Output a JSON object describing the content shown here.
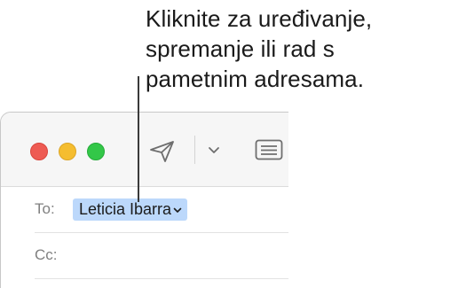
{
  "callout": {
    "lines": [
      "Kliknite za uređivanje,",
      "spremanje ili rad s",
      "pametnim adresama."
    ]
  },
  "window": {
    "traffic_lights": [
      "close",
      "minimize",
      "zoom"
    ],
    "toolbar": {
      "icons": [
        "send-icon",
        "chevron-down-icon",
        "header-fields-icon"
      ]
    },
    "fields": {
      "to_label": "To:",
      "to_recipient": "Leticia Ibarra",
      "cc_label": "Cc:"
    }
  },
  "colors": {
    "recipient_token_bg": "#bcd8fb",
    "close": "#ee5b53",
    "minimize": "#f5bd2f",
    "zoom": "#33c748"
  }
}
